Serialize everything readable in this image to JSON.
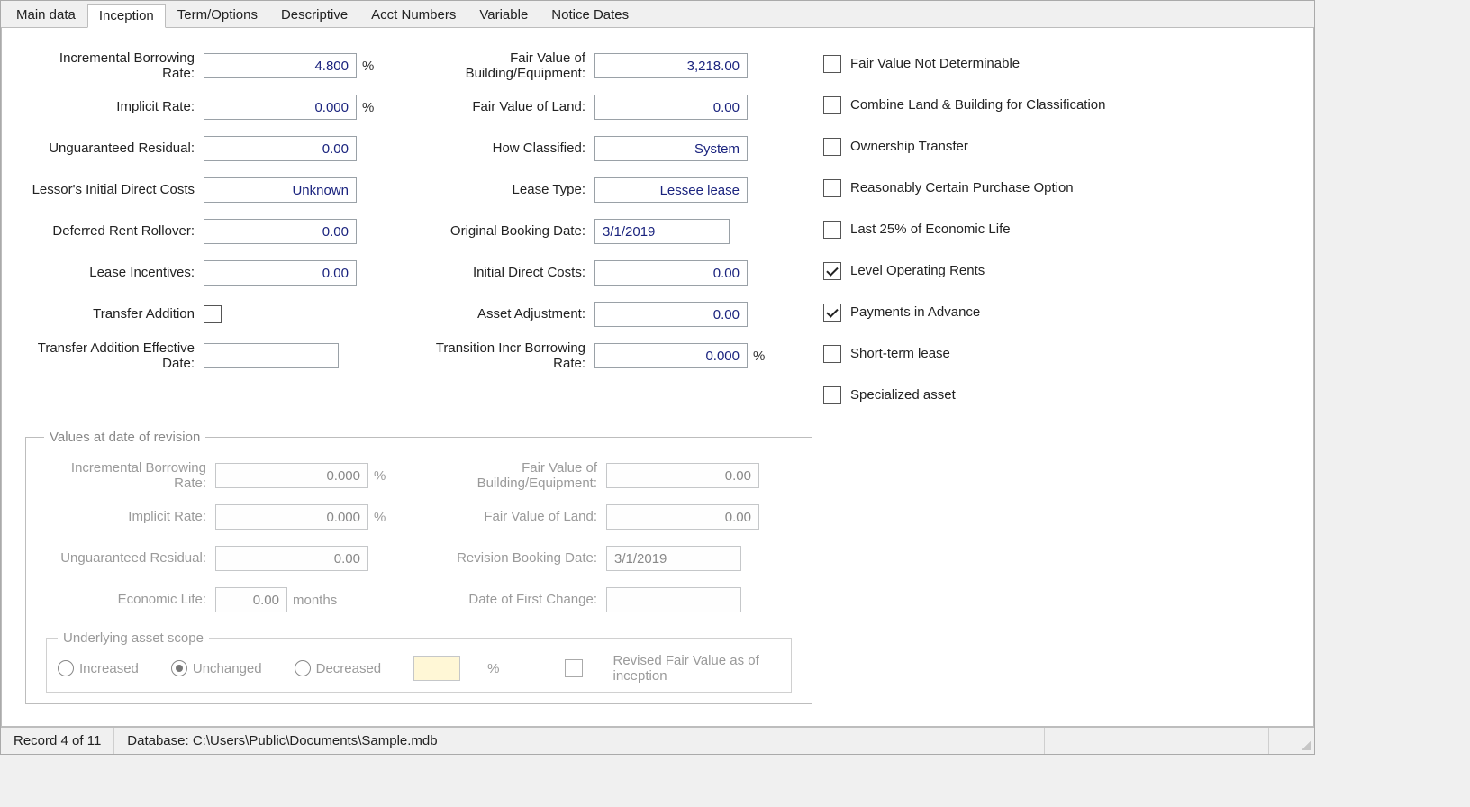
{
  "tabs": [
    "Main data",
    "Inception",
    "Term/Options",
    "Descriptive",
    "Acct Numbers",
    "Variable",
    "Notice Dates"
  ],
  "active_tab_index": 1,
  "left": {
    "ibr_label": "Incremental Borrowing Rate:",
    "ibr": "4.800",
    "implicit_rate_label": "Implicit Rate:",
    "implicit_rate": "0.000",
    "unguar_res_label": "Unguaranteed Residual:",
    "unguar_res": "0.00",
    "lessor_idc_label": "Lessor's Initial Direct Costs",
    "lessor_idc": "Unknown",
    "def_rent_label": "Deferred Rent Rollover:",
    "def_rent": "0.00",
    "lease_inc_label": "Lease Incentives:",
    "lease_inc": "0.00",
    "trans_add_label": "Transfer Addition",
    "trans_add_date_label": "Transfer Addition Effective Date:",
    "trans_add_date": ""
  },
  "mid": {
    "fv_be_label": "Fair Value of Building/Equipment:",
    "fv_be": "3,218.00",
    "fv_land_label": "Fair Value of Land:",
    "fv_land": "0.00",
    "how_class_label": "How Classified:",
    "how_class": "System",
    "lease_type_label": "Lease Type:",
    "lease_type": "Lessee lease",
    "orig_book_label": "Original Booking Date:",
    "orig_book": "3/1/2019",
    "idc_label": "Initial Direct Costs:",
    "idc": "0.00",
    "asset_adj_label": "Asset Adjustment:",
    "asset_adj": "0.00",
    "trans_ibr_label": "Transition Incr Borrowing Rate:",
    "trans_ibr": "0.000"
  },
  "checks": {
    "fvnd": "Fair Value Not Determinable",
    "combine": "Combine Land & Building for Classification",
    "own_trans": "Ownership Transfer",
    "rc_po": "Reasonably Certain Purchase Option",
    "last25": "Last 25% of Economic Life",
    "level_or": "Level Operating Rents",
    "pay_adv": "Payments in Advance",
    "short_term": "Short-term lease",
    "spec_asset": "Specialized asset"
  },
  "revision": {
    "group_title": "Values at date of revision",
    "ibr_label": "Incremental Borrowing Rate:",
    "ibr": "0.000",
    "implicit_label": "Implicit Rate:",
    "implicit": "0.000",
    "unguar_label": "Unguaranteed Residual:",
    "unguar": "0.00",
    "econ_label": "Economic Life:",
    "econ": "0.00",
    "months": "months",
    "fv_be_label": "Fair Value of Building/Equipment:",
    "fv_be": "0.00",
    "fv_land_label": "Fair Value of Land:",
    "fv_land": "0.00",
    "rev_book_label": "Revision Booking Date:",
    "rev_book": "3/1/2019",
    "dofc_label": "Date of First Change:",
    "dofc": "",
    "scope_title": "Underlying asset scope",
    "increased": "Increased",
    "unchanged": "Unchanged",
    "decreased": "Decreased",
    "rfv_label": "Revised Fair Value as of inception"
  },
  "status": {
    "record": "Record 4 of 11",
    "db_label": "Database: ",
    "db_path": "C:\\Users\\Public\\Documents\\Sample.mdb"
  },
  "pct": "%"
}
